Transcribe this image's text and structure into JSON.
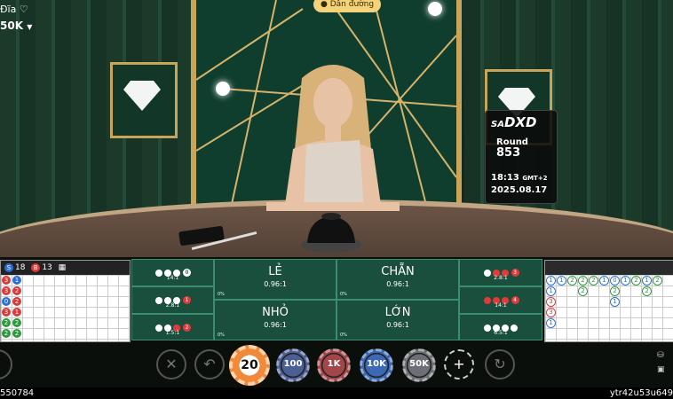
{
  "top_left": {
    "title": "Đĩa",
    "bet_limit": "50K"
  },
  "guide_button": "Dẫn đường",
  "round_card": {
    "logo": "DXD",
    "round_label": "Round",
    "round_number": "853",
    "time": "18:13",
    "gmt": "GMT+2",
    "date": "2025.08.17"
  },
  "left_road": {
    "stats": [
      {
        "label": "S",
        "value": "18"
      },
      {
        "label": "B",
        "value": "13"
      }
    ],
    "cells": [
      {
        "col": 0,
        "row": 0,
        "t": "r",
        "v": "3"
      },
      {
        "col": 1,
        "row": 0,
        "t": "b",
        "v": "1"
      },
      {
        "col": 0,
        "row": 1,
        "t": "r",
        "v": "3"
      },
      {
        "col": 1,
        "row": 1,
        "t": "r",
        "v": "2"
      },
      {
        "col": 0,
        "row": 2,
        "t": "b",
        "v": "0"
      },
      {
        "col": 1,
        "row": 2,
        "t": "r",
        "v": "2"
      },
      {
        "col": 0,
        "row": 3,
        "t": "r",
        "v": "3"
      },
      {
        "col": 1,
        "row": 3,
        "t": "r",
        "v": "1"
      },
      {
        "col": 0,
        "row": 4,
        "t": "g",
        "v": "2"
      },
      {
        "col": 1,
        "row": 4,
        "t": "g",
        "v": "2"
      },
      {
        "col": 0,
        "row": 5,
        "t": "g",
        "v": "2"
      },
      {
        "col": 1,
        "row": 5,
        "t": "g",
        "v": "2"
      }
    ]
  },
  "right_road": {
    "cells": [
      {
        "col": 0,
        "row": 0,
        "t": "ob",
        "v": "1"
      },
      {
        "col": 1,
        "row": 0,
        "t": "ob",
        "v": "1"
      },
      {
        "col": 2,
        "row": 0,
        "t": "o",
        "v": "2"
      },
      {
        "col": 3,
        "row": 0,
        "t": "o",
        "v": "2"
      },
      {
        "col": 4,
        "row": 0,
        "t": "o",
        "v": "2"
      },
      {
        "col": 5,
        "row": 0,
        "t": "ob",
        "v": "1"
      },
      {
        "col": 6,
        "row": 0,
        "t": "ob",
        "v": "0"
      },
      {
        "col": 7,
        "row": 0,
        "t": "ob",
        "v": "1"
      },
      {
        "col": 8,
        "row": 0,
        "t": "o",
        "v": "2"
      },
      {
        "col": 9,
        "row": 0,
        "t": "ob",
        "v": "1"
      },
      {
        "col": 10,
        "row": 0,
        "t": "o",
        "v": "2"
      },
      {
        "col": 0,
        "row": 1,
        "t": "ob",
        "v": "1"
      },
      {
        "col": 3,
        "row": 1,
        "t": "o",
        "v": "2"
      },
      {
        "col": 6,
        "row": 1,
        "t": "o",
        "v": "2"
      },
      {
        "col": 9,
        "row": 1,
        "t": "o",
        "v": "2"
      },
      {
        "col": 0,
        "row": 2,
        "t": "or",
        "v": "3"
      },
      {
        "col": 6,
        "row": 2,
        "t": "ob",
        "v": "1"
      },
      {
        "col": 0,
        "row": 3,
        "t": "or",
        "v": "3"
      },
      {
        "col": 0,
        "row": 4,
        "t": "ob",
        "v": "1"
      }
    ]
  },
  "bets": {
    "le": {
      "name": "LẺ",
      "odds": "0.96:1",
      "pct": "0%"
    },
    "chan": {
      "name": "CHẴN",
      "odds": "0.96:1",
      "pct": "0%"
    },
    "nho": {
      "name": "NHỎ",
      "odds": "0.96:1",
      "pct": "0%"
    },
    "lon": {
      "name": "LỚN",
      "odds": "0.96:1",
      "pct": "0%"
    },
    "side_left": [
      {
        "dots": [
          "w",
          "w",
          "w"
        ],
        "count": "0",
        "count_color": "w",
        "odds": "14:1"
      },
      {
        "dots": [
          "w",
          "w",
          "w"
        ],
        "count": "1",
        "count_color": "rd",
        "odds": "2.8:1"
      },
      {
        "dots": [
          "w",
          "w",
          "rd"
        ],
        "count": "2",
        "count_color": "rd",
        "odds": "1.5:1"
      }
    ],
    "side_right": [
      {
        "dots": [
          "w",
          "rd",
          "rd"
        ],
        "count": "3",
        "count_color": "rd",
        "odds": "2.8:1"
      },
      {
        "dots": [
          "rd",
          "rd",
          "rd"
        ],
        "count": "4",
        "count_color": "rd",
        "odds": "14:1"
      },
      {
        "dots": [
          "w",
          "w",
          "w",
          "w"
        ],
        "count": "",
        "count_color": "w",
        "odds": "6.5:1"
      }
    ]
  },
  "chips": [
    {
      "label": "20",
      "selected": true
    },
    {
      "label": "100",
      "color": "#4b5f95"
    },
    {
      "label": "1K",
      "color": "#a3464a"
    },
    {
      "label": "10K",
      "color": "#3c68b5"
    },
    {
      "label": "50K",
      "color": "#6c6f75"
    }
  ],
  "footer": {
    "left_id": "550784",
    "right_id": "ytr42u53u649"
  }
}
